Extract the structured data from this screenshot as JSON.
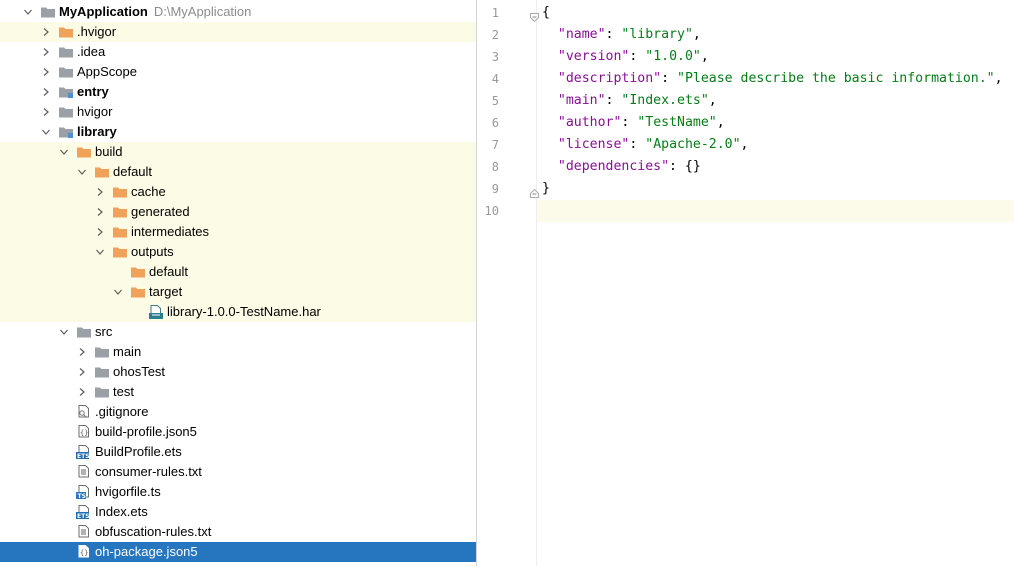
{
  "project_tree": {
    "items": [
      {
        "label": "MyApplication",
        "path": "D:\\MyApplication",
        "indent": 0,
        "arrow": "down",
        "icon": "folder-gray",
        "bold": true,
        "excluded": false,
        "selected": false
      },
      {
        "label": ".hvigor",
        "indent": 1,
        "arrow": "right",
        "icon": "folder-orange",
        "excluded": true
      },
      {
        "label": ".idea",
        "indent": 1,
        "arrow": "right",
        "icon": "folder-gray"
      },
      {
        "label": "AppScope",
        "indent": 1,
        "arrow": "right",
        "icon": "folder-gray"
      },
      {
        "label": "entry",
        "indent": 1,
        "arrow": "right",
        "icon": "module-folder",
        "bold": true
      },
      {
        "label": "hvigor",
        "indent": 1,
        "arrow": "right",
        "icon": "folder-gray"
      },
      {
        "label": "library",
        "indent": 1,
        "arrow": "down",
        "icon": "module-folder",
        "bold": true
      },
      {
        "label": "build",
        "indent": 2,
        "arrow": "down",
        "icon": "folder-orange",
        "excluded": true
      },
      {
        "label": "default",
        "indent": 3,
        "arrow": "down",
        "icon": "folder-orange",
        "excluded": true
      },
      {
        "label": "cache",
        "indent": 4,
        "arrow": "right",
        "icon": "folder-orange",
        "excluded": true
      },
      {
        "label": "generated",
        "indent": 4,
        "arrow": "right",
        "icon": "folder-orange",
        "excluded": true
      },
      {
        "label": "intermediates",
        "indent": 4,
        "arrow": "right",
        "icon": "folder-orange",
        "excluded": true
      },
      {
        "label": "outputs",
        "indent": 4,
        "arrow": "down",
        "icon": "folder-orange",
        "excluded": true
      },
      {
        "label": "default",
        "indent": 5,
        "arrow": "none",
        "icon": "folder-orange",
        "excluded": true
      },
      {
        "label": "target",
        "indent": 5,
        "arrow": "down",
        "icon": "folder-orange",
        "excluded": true
      },
      {
        "label": "library-1.0.0-TestName.har",
        "indent": 6,
        "arrow": "none",
        "icon": "har-file",
        "excluded": true
      },
      {
        "label": "src",
        "indent": 2,
        "arrow": "down",
        "icon": "folder-gray"
      },
      {
        "label": "main",
        "indent": 3,
        "arrow": "right",
        "icon": "folder-gray"
      },
      {
        "label": "ohosTest",
        "indent": 3,
        "arrow": "right",
        "icon": "folder-gray"
      },
      {
        "label": "test",
        "indent": 3,
        "arrow": "right",
        "icon": "folder-gray"
      },
      {
        "label": ".gitignore",
        "indent": 2,
        "arrow": "none",
        "icon": "gitignore-file"
      },
      {
        "label": "build-profile.json5",
        "indent": 2,
        "arrow": "none",
        "icon": "json-file"
      },
      {
        "label": "BuildProfile.ets",
        "indent": 2,
        "arrow": "none",
        "icon": "ets-file"
      },
      {
        "label": "consumer-rules.txt",
        "indent": 2,
        "arrow": "none",
        "icon": "text-file"
      },
      {
        "label": "hvigorfile.ts",
        "indent": 2,
        "arrow": "none",
        "icon": "ts-file"
      },
      {
        "label": "Index.ets",
        "indent": 2,
        "arrow": "none",
        "icon": "ets-file"
      },
      {
        "label": "obfuscation-rules.txt",
        "indent": 2,
        "arrow": "none",
        "icon": "text-file"
      },
      {
        "label": "oh-package.json5",
        "indent": 2,
        "arrow": "none",
        "icon": "json-file",
        "selected": true
      }
    ]
  },
  "editor": {
    "lines": [
      {
        "n": "1",
        "fold": "open",
        "tokens": [
          [
            "punc",
            "{"
          ]
        ]
      },
      {
        "n": "2",
        "tokens": [
          [
            "punc",
            "  "
          ],
          [
            "key",
            "\"name\""
          ],
          [
            "punc",
            ": "
          ],
          [
            "str",
            "\"library\""
          ],
          [
            "punc",
            ","
          ]
        ]
      },
      {
        "n": "3",
        "tokens": [
          [
            "punc",
            "  "
          ],
          [
            "key",
            "\"version\""
          ],
          [
            "punc",
            ": "
          ],
          [
            "str",
            "\"1.0.0\""
          ],
          [
            "punc",
            ","
          ]
        ]
      },
      {
        "n": "4",
        "tokens": [
          [
            "punc",
            "  "
          ],
          [
            "key",
            "\"description\""
          ],
          [
            "punc",
            ": "
          ],
          [
            "str",
            "\"Please describe the basic information.\""
          ],
          [
            "punc",
            ","
          ]
        ]
      },
      {
        "n": "5",
        "tokens": [
          [
            "punc",
            "  "
          ],
          [
            "key",
            "\"main\""
          ],
          [
            "punc",
            ": "
          ],
          [
            "str",
            "\"Index.ets\""
          ],
          [
            "punc",
            ","
          ]
        ]
      },
      {
        "n": "6",
        "tokens": [
          [
            "punc",
            "  "
          ],
          [
            "key",
            "\"author\""
          ],
          [
            "punc",
            ": "
          ],
          [
            "str",
            "\"TestName\""
          ],
          [
            "punc",
            ","
          ]
        ]
      },
      {
        "n": "7",
        "tokens": [
          [
            "punc",
            "  "
          ],
          [
            "key",
            "\"license\""
          ],
          [
            "punc",
            ": "
          ],
          [
            "str",
            "\"Apache-2.0\""
          ],
          [
            "punc",
            ","
          ]
        ]
      },
      {
        "n": "8",
        "tokens": [
          [
            "punc",
            "  "
          ],
          [
            "key",
            "\"dependencies\""
          ],
          [
            "punc",
            ": {}"
          ]
        ]
      },
      {
        "n": "9",
        "fold": "close",
        "tokens": [
          [
            "punc",
            "}"
          ]
        ]
      },
      {
        "n": "10",
        "current": true,
        "tokens": []
      }
    ]
  },
  "colors": {
    "selection": "#2675bf",
    "excluded_bg": "#fcfbe5",
    "folder_orange": "#f0a15a",
    "folder_gray": "#9aa0a6",
    "json_key": "#871094",
    "json_string": "#067d17"
  }
}
